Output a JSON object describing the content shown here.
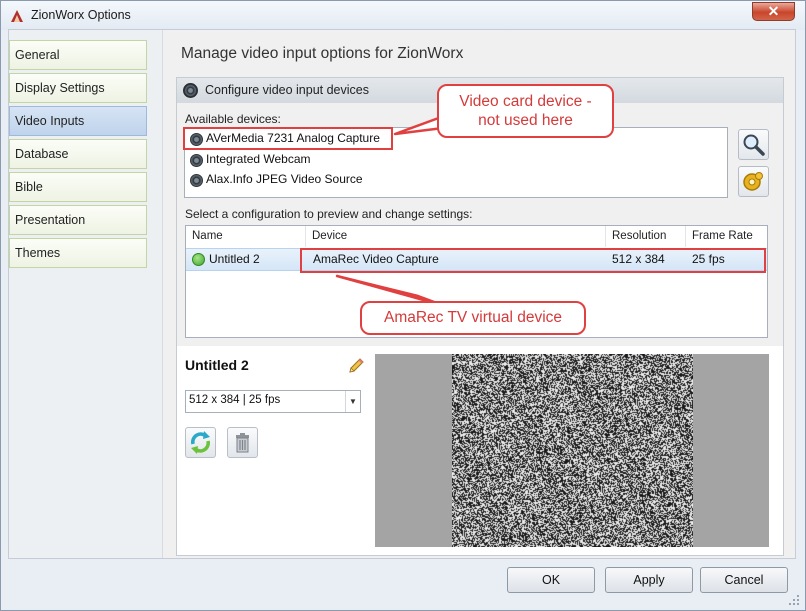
{
  "window": {
    "title": "ZionWorx Options",
    "close_glyph": "✕"
  },
  "nav": {
    "items": [
      {
        "label": "General",
        "active": false
      },
      {
        "label": "Display Settings",
        "active": false
      },
      {
        "label": "Video Inputs",
        "active": true
      },
      {
        "label": "Database",
        "active": false
      },
      {
        "label": "Bible",
        "active": false
      },
      {
        "label": "Presentation",
        "active": false
      },
      {
        "label": "Themes",
        "active": false
      }
    ]
  },
  "main": {
    "title": "Manage video input options for ZionWorx",
    "group_title": "Configure video input devices",
    "available_label": "Available devices:",
    "devices": [
      {
        "name": "AVerMedia 7231 Analog Capture",
        "icon": "camera-icon"
      },
      {
        "name": "Integrated Webcam",
        "icon": "camera-icon"
      },
      {
        "name": "Alax.Info JPEG Video Source",
        "icon": "camera-icon"
      }
    ],
    "side_buttons": {
      "search_icon": "magnifier-icon",
      "settings_icon": "gear-icon"
    },
    "select_label": "Select a configuration to preview and change settings:",
    "table": {
      "columns": [
        "Name",
        "Device",
        "Resolution",
        "Frame Rate"
      ],
      "rows": [
        {
          "name": "Untitled 2",
          "device": "AmaRec Video Capture",
          "resolution": "512 x 384",
          "frame_rate": "25 fps",
          "status_icon": "check-icon"
        }
      ]
    }
  },
  "preview": {
    "config_name": "Untitled 2",
    "format_value": "512 x 384 | 25 fps"
  },
  "callouts": {
    "video_card": "Video card device - not used here",
    "amarec": "AmaRec TV virtual device"
  },
  "buttons": {
    "ok": "OK",
    "apply": "Apply",
    "cancel": "Cancel"
  },
  "colors": {
    "callout_red": "#e04040",
    "selected_nav": "#c9dbf1",
    "row_select": "#dbe9f8"
  }
}
